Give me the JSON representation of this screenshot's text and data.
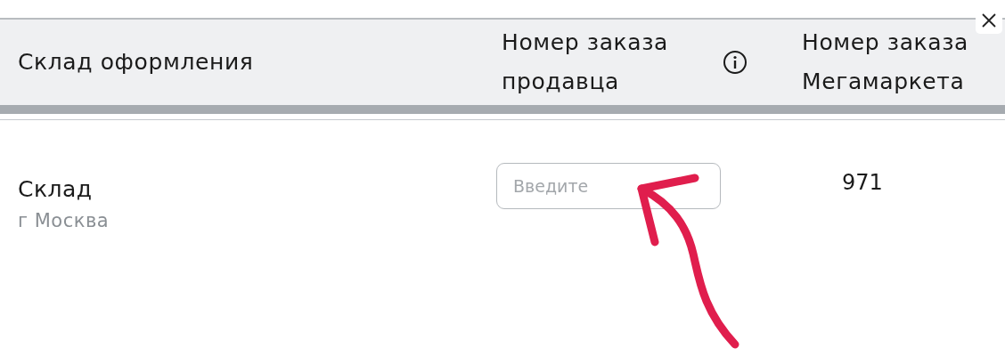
{
  "table": {
    "columns": [
      {
        "label": "Склад оформления",
        "info": false
      },
      {
        "label": "Номер заказа продавца",
        "info": true
      },
      {
        "label": "Номер заказа Мегамаркета",
        "info": false
      }
    ],
    "rows": [
      {
        "warehouse": "Склад",
        "city": "г Москва",
        "seller_order": {
          "placeholder": "Введите"
        },
        "order_number": "971"
      }
    ]
  }
}
